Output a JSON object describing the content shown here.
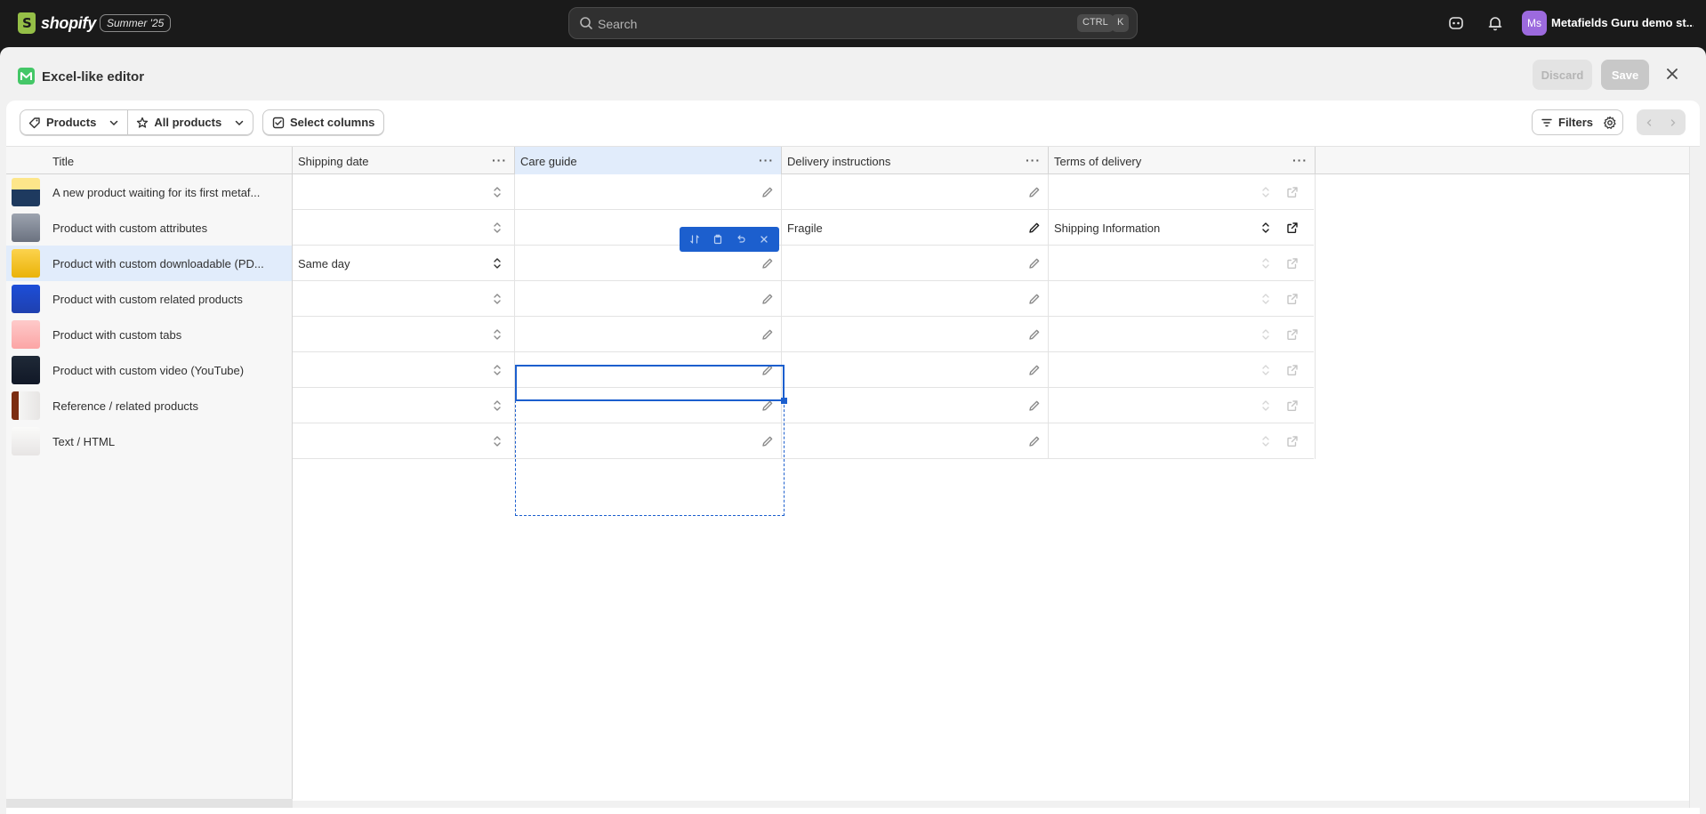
{
  "topbar": {
    "logo_text": "shopify",
    "edition_badge": "Summer '25",
    "search_placeholder": "Search",
    "shortcut_ctrl": "CTRL",
    "shortcut_k": "K",
    "avatar_initials": "Ms",
    "store_name": "Metafields Guru demo st..."
  },
  "modal": {
    "title": "Excel-like editor",
    "discard_label": "Discard",
    "save_label": "Save"
  },
  "toolbar": {
    "resource_label": "Products",
    "view_label": "All products",
    "select_columns_label": "Select columns",
    "filters_label": "Filters"
  },
  "columns": [
    "Title",
    "Shipping date",
    "Care guide",
    "Delivery instructions",
    "Terms of delivery"
  ],
  "rows": [
    {
      "title": "A new product waiting for its first metaf...",
      "shipping": "",
      "care": "",
      "delivery": "",
      "terms": ""
    },
    {
      "title": "Product with custom attributes",
      "shipping": "",
      "care": "",
      "delivery": "Fragile",
      "terms": "Shipping Information"
    },
    {
      "title": "Product with custom downloadable (PD...",
      "shipping": "Same day",
      "care": "",
      "delivery": "",
      "terms": ""
    },
    {
      "title": "Product with custom related products",
      "shipping": "",
      "care": "",
      "delivery": "",
      "terms": ""
    },
    {
      "title": "Product with custom tabs",
      "shipping": "",
      "care": "",
      "delivery": "",
      "terms": ""
    },
    {
      "title": "Product with custom video (YouTube)",
      "shipping": "",
      "care": "",
      "delivery": "",
      "terms": ""
    },
    {
      "title": "Reference / related products",
      "shipping": "",
      "care": "",
      "delivery": "",
      "terms": ""
    },
    {
      "title": "Text / HTML",
      "shipping": "",
      "care": "",
      "delivery": "",
      "terms": ""
    }
  ],
  "colors": {
    "accent": "#1c5fce",
    "selected_bg": "#e1ecfb",
    "topbar_bg": "#1a1a1a"
  }
}
